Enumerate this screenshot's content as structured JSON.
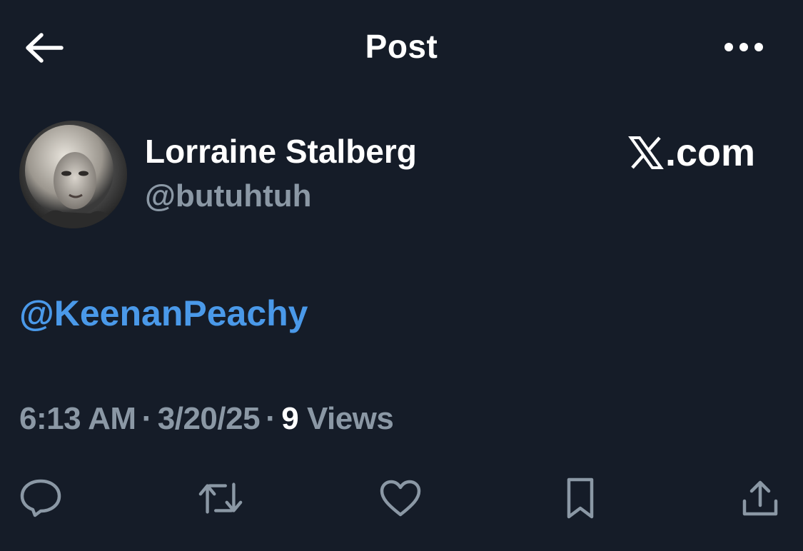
{
  "header": {
    "title": "Post",
    "back_icon": "arrow-left-icon",
    "more_icon": "more-horizontal-icon"
  },
  "author": {
    "display_name": "Lorraine Stalberg",
    "handle": "@butuhtuh",
    "avatar_icon": "avatar-photo"
  },
  "brand": {
    "text": ".com",
    "icon": "x-logo-icon"
  },
  "post": {
    "mention": "@KeenanPeachy"
  },
  "meta": {
    "time": "6:13 AM",
    "separator": "·",
    "date": "3/20/25",
    "views_count": "9",
    "views_label": "Views"
  },
  "actions": {
    "reply_icon": "reply-icon",
    "repost_icon": "repost-icon",
    "like_icon": "heart-icon",
    "bookmark_icon": "bookmark-icon",
    "share_icon": "share-icon"
  },
  "colors": {
    "background": "#151c28",
    "text_primary": "#ffffff",
    "text_secondary": "#8b98a5",
    "accent": "#4a99e9"
  }
}
